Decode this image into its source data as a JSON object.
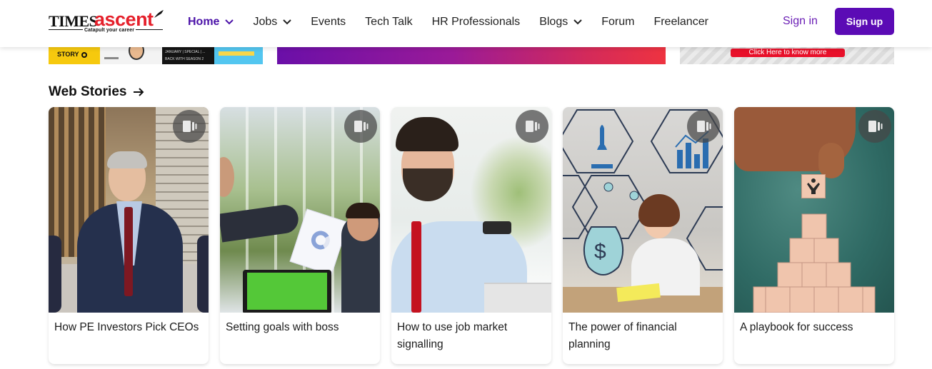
{
  "logo": {
    "word1": "TIMES",
    "word2": "ascent",
    "tagline": "Catapult your career"
  },
  "nav": {
    "items": [
      {
        "label": "Home",
        "dropdown": true,
        "active": true
      },
      {
        "label": "Jobs",
        "dropdown": true,
        "active": false
      },
      {
        "label": "Events",
        "dropdown": false,
        "active": false
      },
      {
        "label": "Tech Talk",
        "dropdown": false,
        "active": false
      },
      {
        "label": "HR Professionals",
        "dropdown": false,
        "active": false
      },
      {
        "label": "Blogs",
        "dropdown": true,
        "active": false
      },
      {
        "label": "Forum",
        "dropdown": false,
        "active": false
      },
      {
        "label": "Freelancer",
        "dropdown": false,
        "active": false
      }
    ],
    "signin": "Sign in",
    "signup": "Sign up"
  },
  "banners": {
    "left": {
      "tile1_text": "STORY",
      "tile3_text": "JANUARY | SPECIAL | ...",
      "tile3_sub": "BACK WITH SEASON 2"
    },
    "right_cta": "Click Here to know more"
  },
  "web_stories": {
    "title": "Web Stories",
    "cards": [
      {
        "title": "How PE Investors Pick CEOs"
      },
      {
        "title": "Setting goals with boss"
      },
      {
        "title": "How to use job market signalling"
      },
      {
        "title": "The power of financial planning"
      },
      {
        "title": "A playbook for success"
      }
    ]
  },
  "colors": {
    "brand_red": "#e5202b",
    "nav_active": "#4b12a8",
    "signup_bg": "#5b0bb5",
    "signin_text": "#6b1fb5"
  },
  "icons": {
    "nav_chevron": "chevron-down-icon",
    "section_arrow": "arrow-right-icon",
    "story_badge": "web-story-icon"
  }
}
